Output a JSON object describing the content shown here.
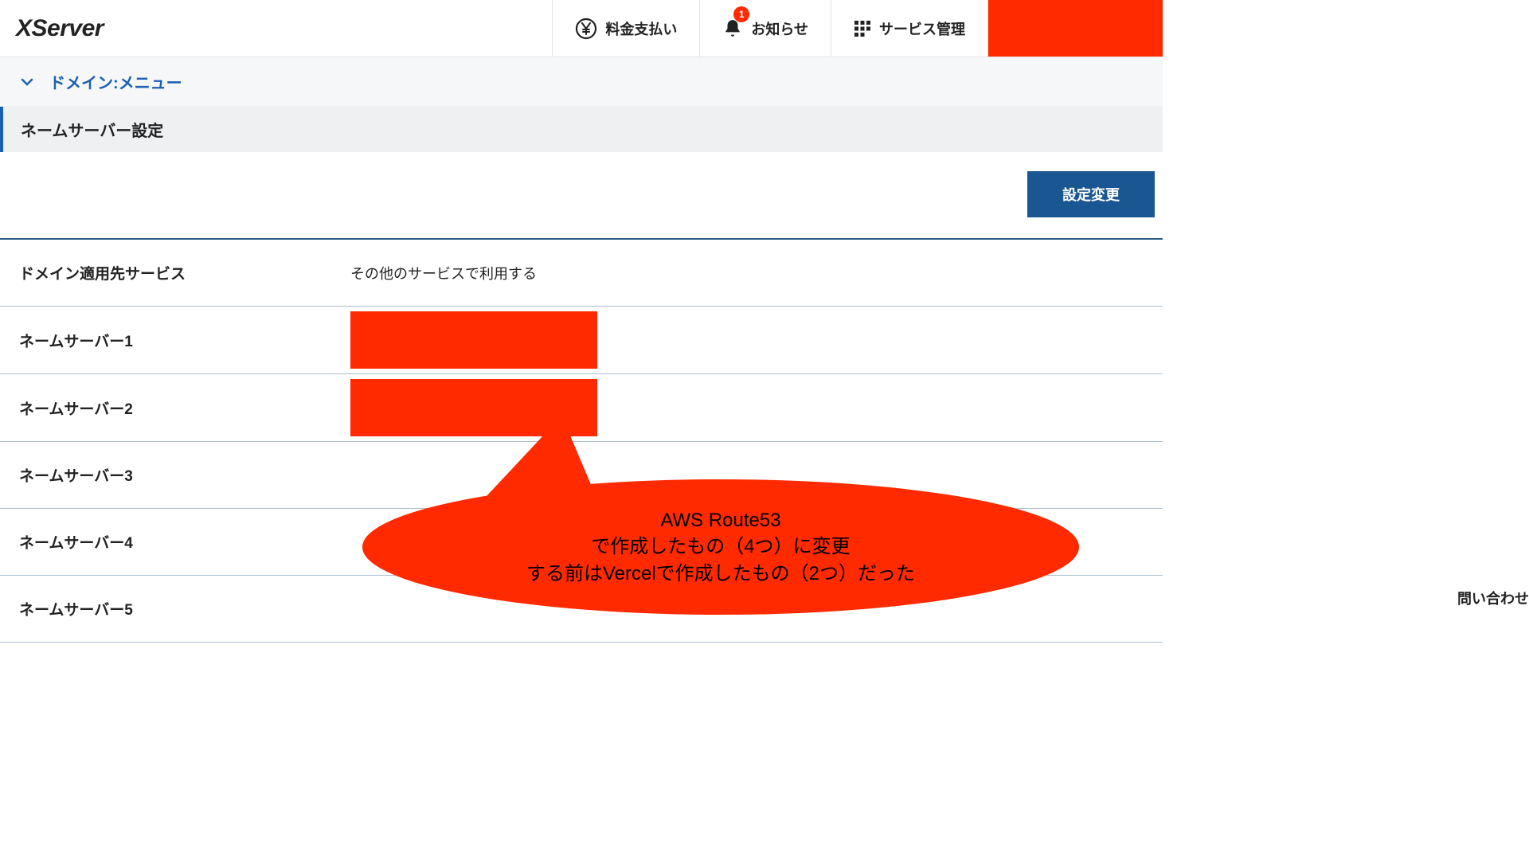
{
  "header": {
    "logo": "XServer",
    "nav": {
      "payment": "料金支払い",
      "notice": "お知らせ",
      "notice_badge": "1",
      "service": "サービス管理"
    }
  },
  "breadcrumb": {
    "label": "ドメイン:メニュー"
  },
  "section": {
    "title": "ネームサーバー設定"
  },
  "actions": {
    "change": "設定変更"
  },
  "rows": {
    "service_label": "ドメイン適用先サービス",
    "service_value": "その他のサービスで利用する",
    "ns1_label": "ネームサーバー1",
    "ns2_label": "ネームサーバー2",
    "ns3_label": "ネームサーバー3",
    "ns4_label": "ネームサーバー4",
    "ns5_label": "ネームサーバー5"
  },
  "annotation": {
    "line1": "AWS Route53",
    "line2": "で作成したもの（4つ）に変更",
    "line3": "する前はVercelで作成したもの（2つ）だった"
  },
  "footer": {
    "inquiry": "問い合わせ"
  }
}
